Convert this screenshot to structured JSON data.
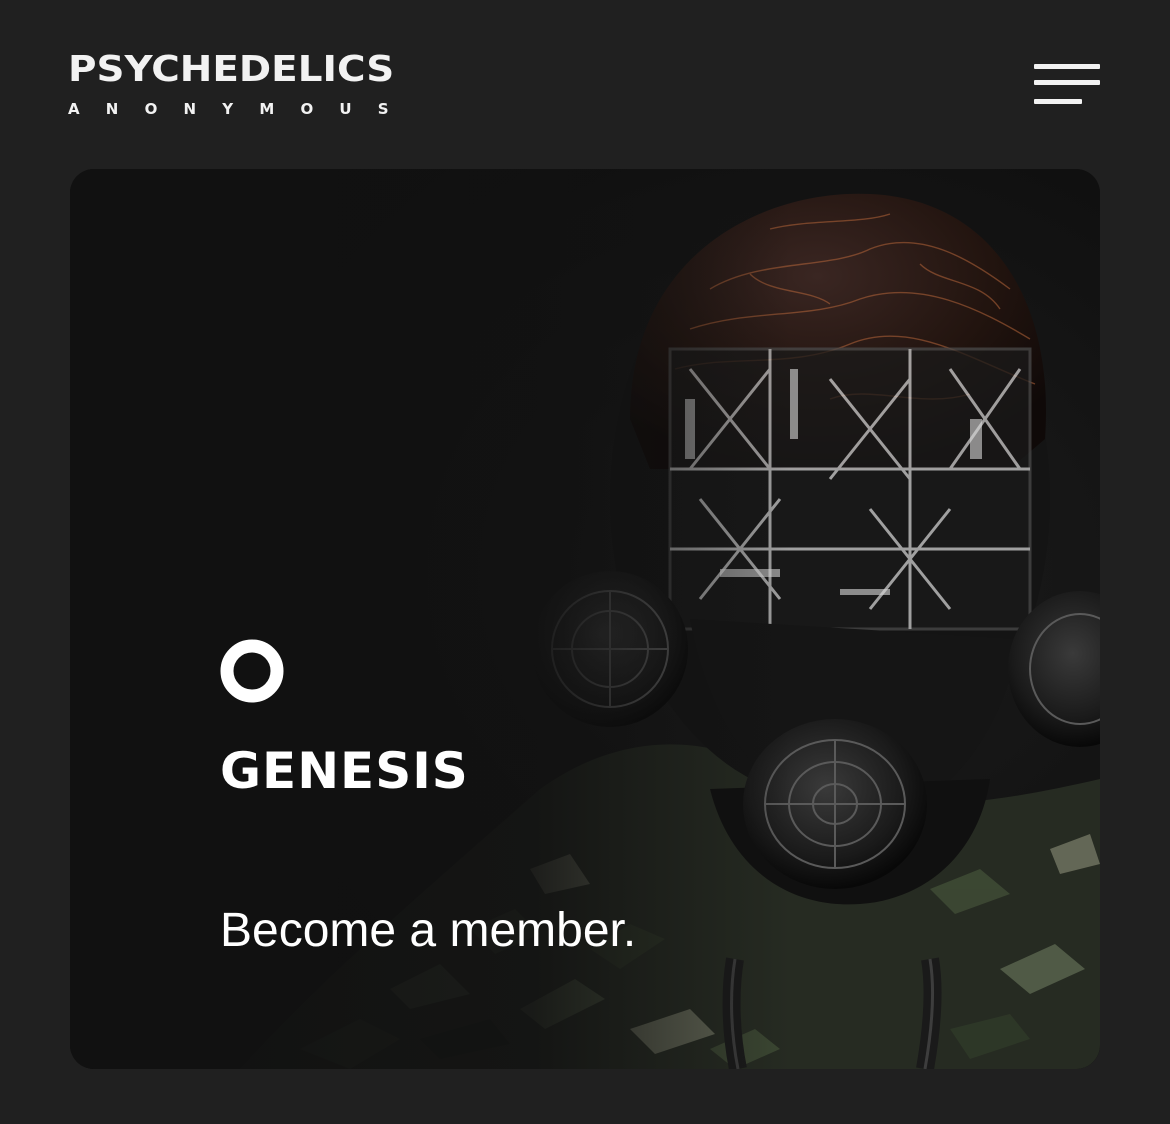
{
  "header": {
    "logo_main": "PSYCHEDELICS",
    "logo_sub": "ANONYMOUS",
    "menu_icon": "hamburger-menu-icon"
  },
  "hero": {
    "ring_icon": "ring-icon",
    "title": "GENESIS",
    "cta": "Become a member.",
    "art_icon": "gas-mask-figure-illustration"
  },
  "colors": {
    "page_background": "#202020",
    "card_background": "#111111",
    "text": "#ffffff",
    "camo_green": "#3e4a34",
    "accent_copper": "#b5653a"
  }
}
